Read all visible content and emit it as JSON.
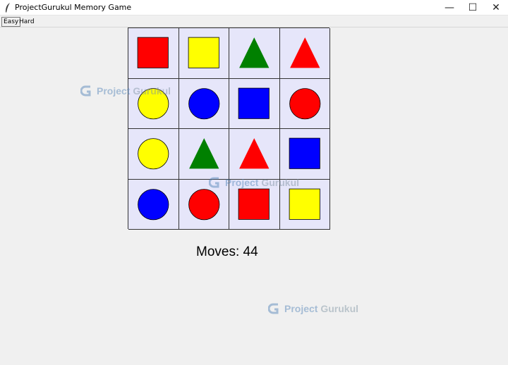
{
  "window": {
    "title": "ProjectGurukul Memory Game",
    "icon": "feather-icon",
    "controls": {
      "minimize": "—",
      "maximize": "☐",
      "close": "✕"
    }
  },
  "menu": {
    "easy_label": "Easy",
    "hard_label": "Hard",
    "selected": "Easy"
  },
  "board": {
    "rows": 4,
    "cols": 4,
    "tile_color": "#e6e6fa",
    "tiles": [
      [
        {
          "shape": "square",
          "color": "#ff0000"
        },
        {
          "shape": "square",
          "color": "#ffff00"
        },
        {
          "shape": "triangle",
          "color": "#008000"
        },
        {
          "shape": "triangle",
          "color": "#ff0000"
        }
      ],
      [
        {
          "shape": "circle",
          "color": "#ffff00"
        },
        {
          "shape": "circle",
          "color": "#0000ff"
        },
        {
          "shape": "square",
          "color": "#0000ff"
        },
        {
          "shape": "circle",
          "color": "#ff0000"
        }
      ],
      [
        {
          "shape": "circle",
          "color": "#ffff00"
        },
        {
          "shape": "triangle",
          "color": "#008000"
        },
        {
          "shape": "triangle",
          "color": "#ff0000"
        },
        {
          "shape": "square",
          "color": "#0000ff"
        }
      ],
      [
        {
          "shape": "circle",
          "color": "#0000ff"
        },
        {
          "shape": "circle",
          "color": "#ff0000"
        },
        {
          "shape": "square",
          "color": "#ff0000"
        },
        {
          "shape": "square",
          "color": "#ffff00"
        }
      ]
    ]
  },
  "status": {
    "moves_text": "Moves: 44"
  },
  "watermark": {
    "prefix": "Project",
    "suffix": "Gurukul"
  }
}
